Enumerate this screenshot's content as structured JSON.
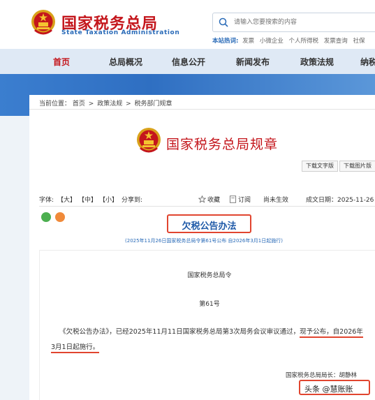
{
  "header": {
    "site_title": "国家税务总局",
    "site_subtitle": "State Taxation Administration",
    "search_placeholder": "请输入您要搜索的内容",
    "hot_label": "本站热词:",
    "hot_words": [
      "发票",
      "小微企业",
      "个人所得税",
      "发票查询",
      "社保"
    ]
  },
  "nav": {
    "items": [
      "首页",
      "总局概况",
      "信息公开",
      "新闻发布",
      "政策法规",
      "纳税"
    ]
  },
  "breadcrumb": {
    "prefix": "当前位置：",
    "items": [
      "首页",
      "政策法规",
      "税务部门规章"
    ],
    "separator": ">"
  },
  "rules": {
    "title": "国家税务总局规章",
    "download_text": "下载文字版",
    "download_image": "下载图片版"
  },
  "toolbar": {
    "font_label": "字体:",
    "font_large": "【大】",
    "font_medium": "【中】",
    "font_small": "【小】",
    "share_label": "分享到:",
    "favorite": "收藏",
    "subscribe": "订阅",
    "status": "尚未生效",
    "date": "成文日期：2025-11-26"
  },
  "document": {
    "title": "欠税公告办法",
    "subtitle": "(2025年11月26日国家税务总局令第61号公布 自2026年3月1日起施行)",
    "issuer": "国家税务总局令",
    "order_no": "第61号",
    "para_part1": "《欠税公告办法》，已经2025年11月11日国家税务总局第3次局务会议审议通过，",
    "para_highlight1": "现予公布，自2026年",
    "para_highlight2": "3月1日起施行。",
    "director": "国家税务总局局长：胡静林"
  },
  "watermark": {
    "text": "头条 @慧账账"
  },
  "colors": {
    "brand_red": "#c4161c",
    "nav_bg": "#dfe9f5",
    "banner_blue": "#2f6fc2",
    "highlight_red": "#e1452f",
    "link_blue": "#2a6bb8"
  }
}
